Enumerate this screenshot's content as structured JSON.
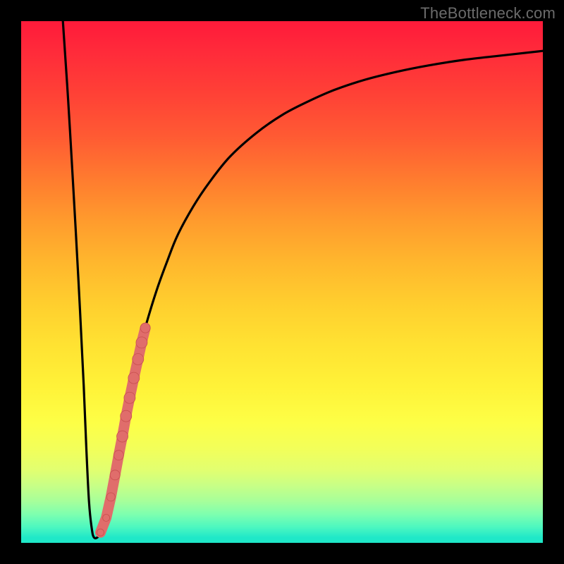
{
  "watermark": "TheBottleneck.com",
  "colors": {
    "frame": "#000000",
    "curve": "#000000",
    "marker_fill": "#e06d6b",
    "marker_stroke": "#c74f4d",
    "gradient_top": "#ff1a3a",
    "gradient_bottom": "#1fe8c8"
  },
  "chart_data": {
    "type": "line",
    "title": "",
    "xlabel": "",
    "ylabel": "",
    "xlim": [
      0,
      100
    ],
    "ylim": [
      0,
      100
    ],
    "series": [
      {
        "name": "bottleneck-curve",
        "x": [
          8,
          9,
          10,
          11,
          12,
          12.5,
          13,
          13.5,
          14,
          15,
          16,
          17,
          18,
          19,
          20,
          21,
          22,
          23,
          24,
          26,
          28,
          30,
          33,
          36,
          40,
          45,
          50,
          55,
          60,
          66,
          72,
          78,
          85,
          92,
          100
        ],
        "y": [
          100,
          85,
          68,
          50,
          30,
          18,
          8,
          3,
          1,
          1.5,
          4,
          8,
          13,
          18.5,
          24,
          29,
          33.5,
          38,
          42,
          48.5,
          54,
          59,
          64.5,
          69,
          74,
          78.5,
          82,
          84.6,
          86.8,
          88.8,
          90.3,
          91.5,
          92.6,
          93.4,
          94.3
        ]
      }
    ],
    "markers": {
      "name": "highlighted-points",
      "points": [
        {
          "x": 15.2,
          "y": 2.0,
          "r": 5
        },
        {
          "x": 16.3,
          "y": 4.8,
          "r": 5
        },
        {
          "x": 17.2,
          "y": 8.8,
          "r": 6
        },
        {
          "x": 18.0,
          "y": 13.0,
          "r": 7
        },
        {
          "x": 18.7,
          "y": 16.8,
          "r": 7
        },
        {
          "x": 19.4,
          "y": 20.4,
          "r": 8
        },
        {
          "x": 20.1,
          "y": 24.3,
          "r": 8
        },
        {
          "x": 20.8,
          "y": 27.8,
          "r": 8
        },
        {
          "x": 21.6,
          "y": 31.6,
          "r": 8
        },
        {
          "x": 22.4,
          "y": 35.2,
          "r": 8
        },
        {
          "x": 23.1,
          "y": 38.4,
          "r": 8
        },
        {
          "x": 23.8,
          "y": 41.2,
          "r": 7
        }
      ]
    }
  }
}
